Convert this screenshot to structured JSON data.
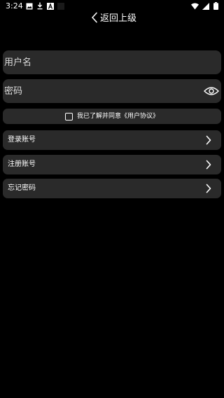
{
  "status_bar": {
    "time": "3:24",
    "notification_icons": [
      "image-icon",
      "download-icon",
      "font-a-icon",
      "dark-square-icon"
    ],
    "system_icons": [
      "wifi-icon",
      "signal-icon",
      "battery-icon"
    ]
  },
  "nav": {
    "back_label": "返回上级"
  },
  "form": {
    "username_placeholder": "用户名",
    "username_value": "",
    "password_placeholder": "密码",
    "password_value": ""
  },
  "agreement": {
    "text": "我已了解并同意《用户协议》",
    "checked": false
  },
  "menu": {
    "items": [
      {
        "label": "登录账号"
      },
      {
        "label": "注册账号"
      },
      {
        "label": "忘记密码"
      }
    ]
  },
  "colors": {
    "background": "#000000",
    "card": "#2a2a2a",
    "text": "#ffffff"
  }
}
